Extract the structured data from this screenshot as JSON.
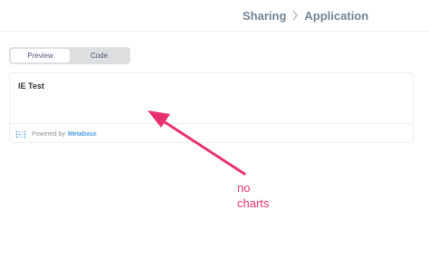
{
  "header": {
    "breadcrumb": {
      "parent": "Sharing",
      "current": "Application"
    }
  },
  "toggle": {
    "tabs": [
      {
        "label": "Preview",
        "active": true
      },
      {
        "label": "Code",
        "active": false
      }
    ]
  },
  "card": {
    "title": "IE Test",
    "footer": {
      "prefix": "Powered by",
      "brand": "Metabase"
    }
  },
  "annotation": {
    "lines": [
      "no",
      "charts"
    ],
    "color": "#e8306f"
  },
  "colors": {
    "brand": "#509ee3",
    "annotation": "#e8306f",
    "breadcrumb": "#74838f"
  },
  "icons": {
    "breadcrumb_separator": "chevron-right-icon",
    "footer_logo": "metabase-logo-icon"
  }
}
